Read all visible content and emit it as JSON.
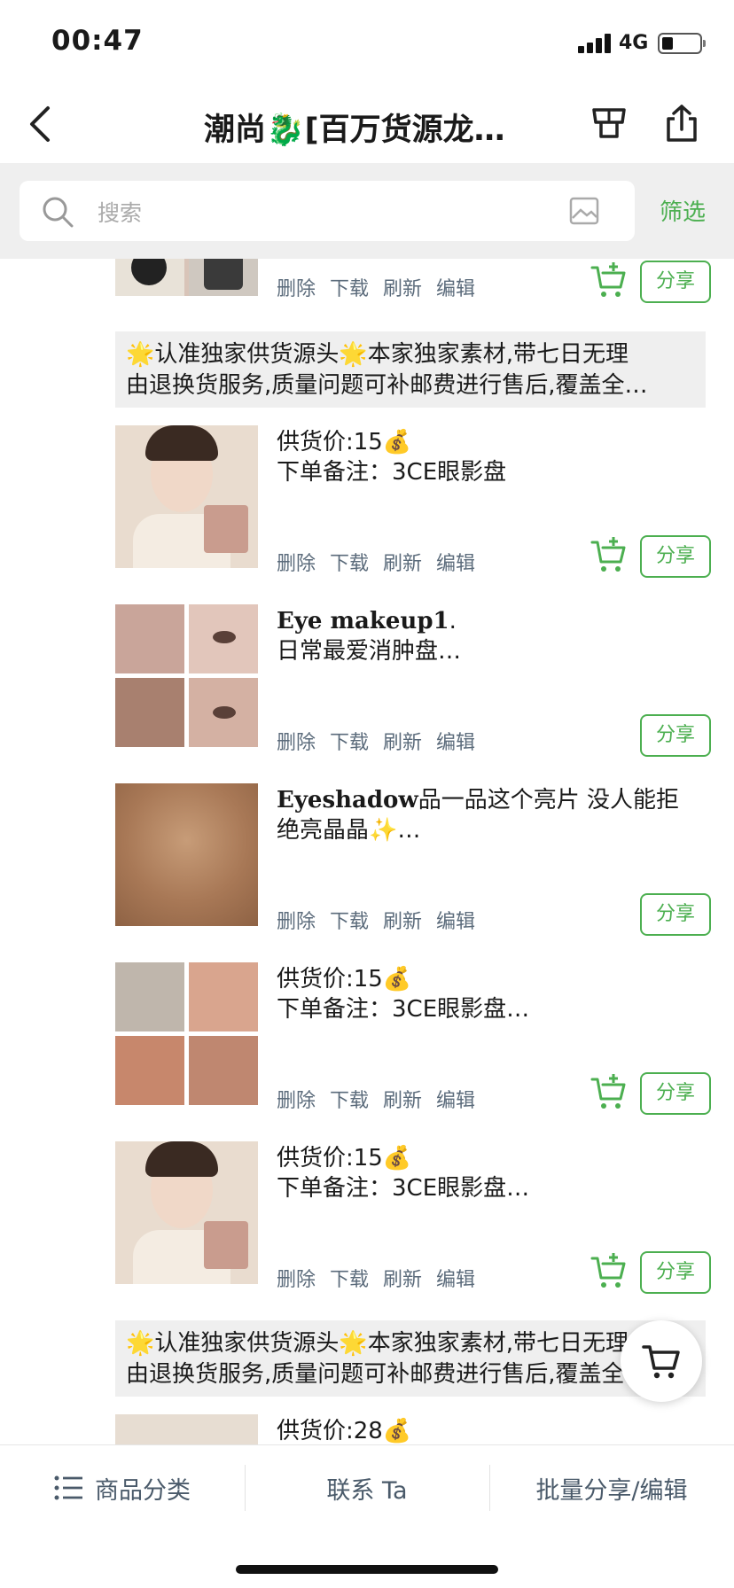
{
  "status": {
    "time": "00:47",
    "network": "4G"
  },
  "nav": {
    "title": "潮尚🐉[百万货源龙…"
  },
  "search": {
    "placeholder": "搜索",
    "filter_label": "筛选"
  },
  "actions": {
    "delete": "删除",
    "download": "下载",
    "refresh": "刷新",
    "edit": "编辑",
    "share": "分享"
  },
  "feed": {
    "notice1": {
      "line1": "🌟认准独家供货源头🌟本家独家素材,带七日无理",
      "line2": "由退换货服务,质量问题可补邮费进行售后,覆盖全…"
    },
    "item2": {
      "line1": "供货价:15💰",
      "line2": "下单备注：3CE眼影盘"
    },
    "item3": {
      "line1_bold": "Eye makeup1",
      "line1_rest": ".",
      "line2": "日常最爱消肿盘…"
    },
    "item4": {
      "line1_bold": "Eyeshadow",
      "line1_rest": "品一品这个亮片 没人能拒",
      "line2": "绝亮晶晶✨…"
    },
    "item5": {
      "line1": "供货价:15💰",
      "line2": "下单备注：3CE眼影盘…"
    },
    "item6": {
      "line1": "供货价:15💰",
      "line2": "下单备注：3CE眼影盘…"
    },
    "notice2": {
      "line1": "🌟认准独家供货源头🌟本家独家素材,带七日无理",
      "line2": "由退换货服务,质量问题可补邮费进行售后,覆盖全…"
    },
    "item7": {
      "line1": "供货价:28💰"
    }
  },
  "bottom": {
    "category": "商品分类",
    "contact": "联系 Ta",
    "batch": "批量分享/编辑"
  },
  "colors": {
    "accent": "#4caf50",
    "action_text": "#5b6b7b",
    "page_bg": "#ffffff",
    "search_bg": "#efefef"
  }
}
